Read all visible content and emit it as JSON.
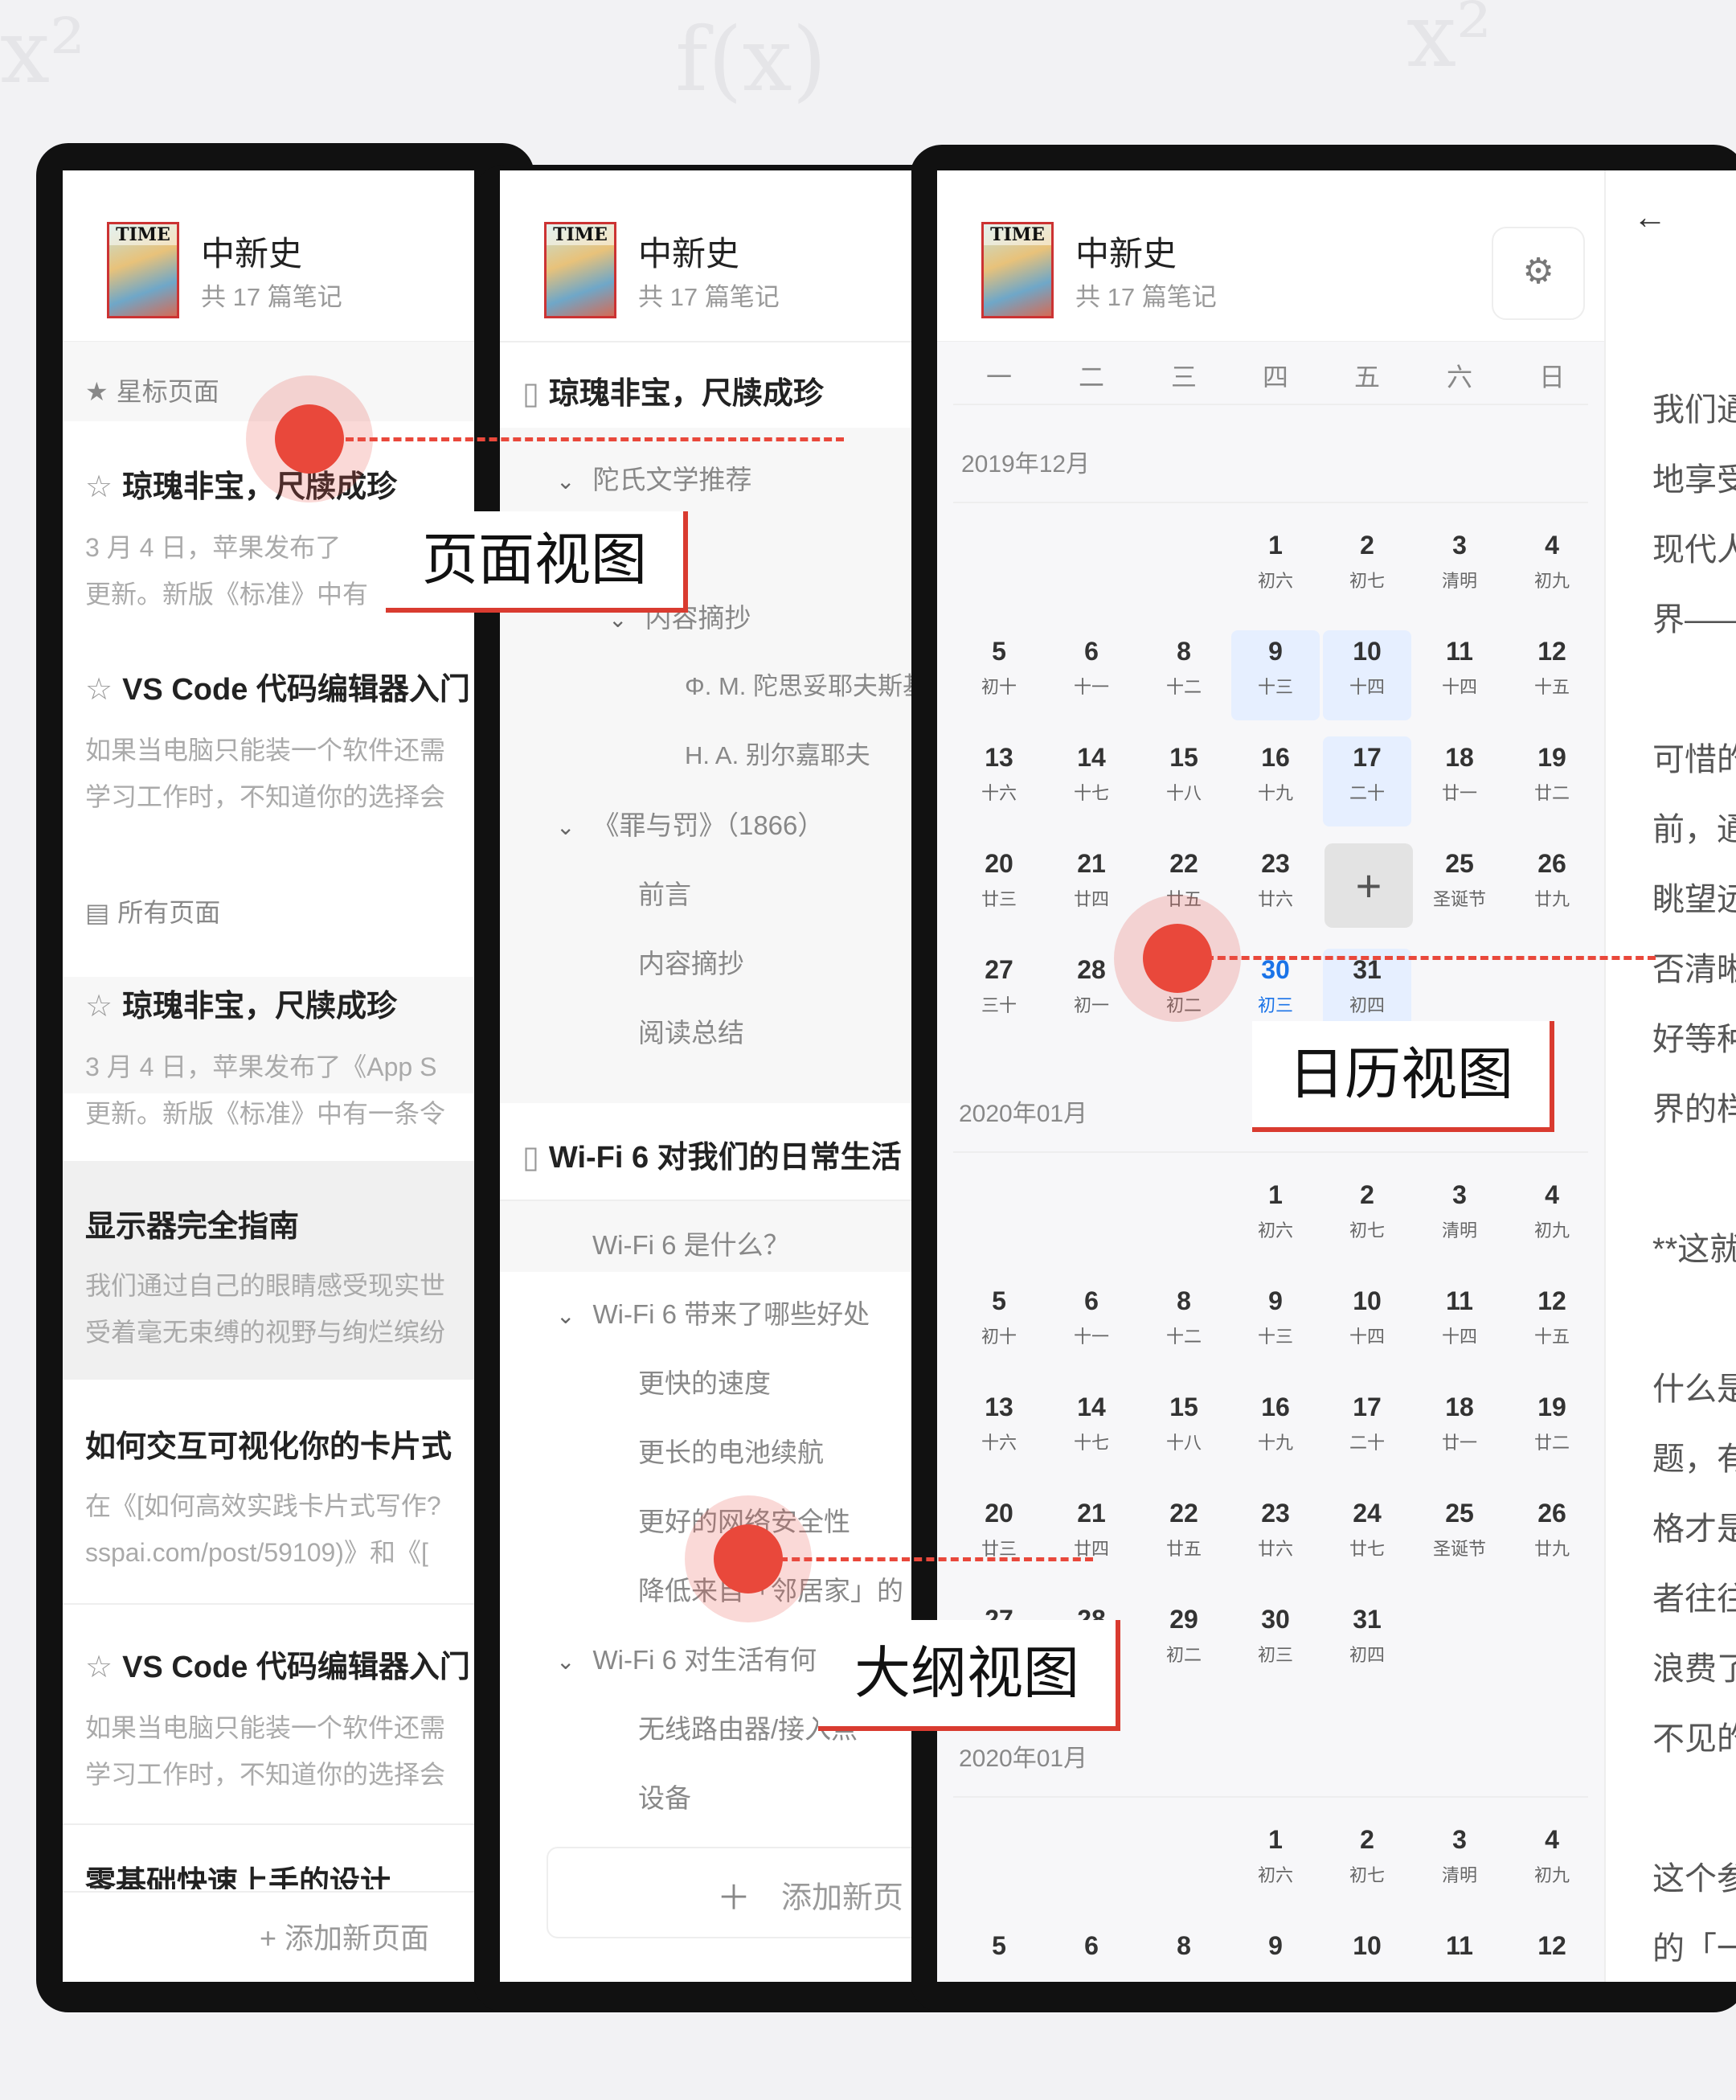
{
  "colors": {
    "accent": "#e9483b",
    "highlight_bg": "#e6efff",
    "today": "#1a73e8"
  },
  "notebook": {
    "title": "中新史",
    "count": "共 17 篇笔记",
    "cover_text": "TIME"
  },
  "page_view": {
    "starred_label": "星标页面",
    "all_label": "所有页面",
    "add_label": "+ 添加新页面",
    "items": [
      {
        "title": "琼瑰非宝，尺牍成珍",
        "excerpt": [
          "3 月 4 日，苹果发布了",
          "更新。新版《标准》中有"
        ]
      },
      {
        "title": "VS Code 代码编辑器入门",
        "excerpt": [
          "如果当电脑只能装一个软件还需",
          "学习工作时，不知道你的选择会"
        ]
      },
      {
        "title": "琼瑰非宝，尺牍成珍",
        "excerpt": [
          "3 月 4 日，苹果发布了《App S",
          "更新。新版《标准》中有一条令"
        ]
      },
      {
        "title": "显示器完全指南",
        "excerpt": [
          "我们通过自己的眼睛感受现实世",
          "受着毫无束缚的视野与绚烂缤纷"
        ]
      },
      {
        "title": "如何交互可视化你的卡片式",
        "excerpt": [
          "在《[如何高效实践卡片式写作?",
          "sspai.com/post/59109)》和《["
        ]
      },
      {
        "title": "VS Code 代码编辑器入门",
        "excerpt": [
          "如果当电脑只能装一个软件还需",
          "学习工作时，不知道你的选择会"
        ]
      },
      {
        "title": "零基础快速上手的设计",
        "excerpt": []
      }
    ]
  },
  "outline_view": {
    "doc1": "琼瑰非宝，尺牍成珍",
    "doc2": "Wi-Fi 6 对我们的日常生活",
    "add_label": "添加新页",
    "items": [
      {
        "text": "陀氏文学推荐",
        "chev": true
      },
      {
        "text": "前言",
        "chev": false
      },
      {
        "text": "内容摘抄",
        "chev": true
      },
      {
        "text": "Φ. M. 陀思妥耶夫斯基",
        "chev": false
      },
      {
        "text": "H. A. 别尔嘉耶夫",
        "chev": false
      },
      {
        "text": "《罪与罚》（1866）",
        "chev": true
      },
      {
        "text": "前言",
        "chev": false
      },
      {
        "text": "内容摘抄",
        "chev": false
      },
      {
        "text": "阅读总结",
        "chev": false
      },
      {
        "text": "Wi-Fi 6 是什么？",
        "chev": false
      },
      {
        "text": "Wi-Fi 6 带来了哪些好处",
        "chev": true
      },
      {
        "text": "更快的速度",
        "chev": false
      },
      {
        "text": "更长的电池续航",
        "chev": false
      },
      {
        "text": "更好的网络安全性",
        "chev": false
      },
      {
        "text": "降低来自「邻居家」的",
        "chev": false
      },
      {
        "text": "Wi-Fi 6 对生活有何",
        "chev": true
      },
      {
        "text": "无线路由器/接入点",
        "chev": false
      },
      {
        "text": "设备",
        "chev": false
      }
    ]
  },
  "calendar_view": {
    "weekdays": [
      "一",
      "二",
      "三",
      "四",
      "五",
      "六",
      "日"
    ],
    "months": [
      "2019年12月",
      "2020年01月",
      "2020年01月"
    ],
    "dec_rows": [
      [
        null,
        null,
        null,
        [
          "1",
          "初六"
        ],
        [
          "2",
          "初七"
        ],
        [
          "3",
          "清明"
        ],
        [
          "4",
          "初九"
        ]
      ],
      [
        [
          "5",
          "初十"
        ],
        [
          "6",
          "十一"
        ],
        [
          "8",
          "十二"
        ],
        [
          "9",
          "十三"
        ],
        [
          "10",
          "十四"
        ],
        [
          "11",
          "十四"
        ],
        [
          "12",
          "十五"
        ]
      ],
      [
        [
          "13",
          "十六"
        ],
        [
          "14",
          "十七"
        ],
        [
          "15",
          "十八"
        ],
        [
          "16",
          "十九"
        ],
        [
          "17",
          "二十"
        ],
        [
          "18",
          "廿一"
        ],
        [
          "19",
          "廿二"
        ]
      ],
      [
        [
          "20",
          "廿三"
        ],
        [
          "21",
          "廿四"
        ],
        [
          "22",
          "廿五"
        ],
        [
          "23",
          "廿六"
        ],
        [
          "+",
          ""
        ],
        [
          "25",
          "圣诞节"
        ],
        [
          "26",
          "廿九"
        ]
      ],
      [
        [
          "27",
          "三十"
        ],
        [
          "28",
          "初一"
        ],
        [
          "29",
          "初二"
        ],
        [
          "30",
          "初三"
        ],
        [
          "31",
          "初四"
        ],
        null,
        null
      ]
    ],
    "jan_rows": [
      [
        null,
        null,
        null,
        [
          "1",
          "初六"
        ],
        [
          "2",
          "初七"
        ],
        [
          "3",
          "清明"
        ],
        [
          "4",
          "初九"
        ]
      ],
      [
        [
          "5",
          "初十"
        ],
        [
          "6",
          "十一"
        ],
        [
          "8",
          "十二"
        ],
        [
          "9",
          "十三"
        ],
        [
          "10",
          "十四"
        ],
        [
          "11",
          "十四"
        ],
        [
          "12",
          "十五"
        ]
      ],
      [
        [
          "13",
          "十六"
        ],
        [
          "14",
          "十七"
        ],
        [
          "15",
          "十八"
        ],
        [
          "16",
          "十九"
        ],
        [
          "17",
          "二十"
        ],
        [
          "18",
          "廿一"
        ],
        [
          "19",
          "廿二"
        ]
      ],
      [
        [
          "20",
          "廿三"
        ],
        [
          "21",
          "廿四"
        ],
        [
          "22",
          "廿五"
        ],
        [
          "23",
          "廿六"
        ],
        [
          "24",
          "廿七"
        ],
        [
          "25",
          "圣诞节"
        ],
        [
          "26",
          "廿九"
        ]
      ],
      [
        [
          "27",
          "三十"
        ],
        [
          "28",
          "初一"
        ],
        [
          "29",
          "初二"
        ],
        [
          "30",
          "初三"
        ],
        [
          "31",
          "初四"
        ],
        null,
        null
      ]
    ],
    "jan2_rows": [
      [
        null,
        null,
        null,
        [
          "1",
          "初六"
        ],
        [
          "2",
          "初七"
        ],
        [
          "3",
          "清明"
        ],
        [
          "4",
          "初九"
        ]
      ],
      [
        [
          "5",
          ""
        ],
        [
          "6",
          ""
        ],
        [
          "8",
          ""
        ],
        [
          "9",
          ""
        ],
        [
          "10",
          ""
        ],
        [
          "11",
          ""
        ],
        [
          "12",
          ""
        ]
      ]
    ]
  },
  "reader": {
    "back": "←",
    "lines": [
      "我们通",
      "地享受",
      "现代人",
      "界——",
      "",
      "可惜的",
      "前，通",
      "眺望远",
      "否清晰",
      "好等种",
      "界的样",
      "",
      "**这就",
      "",
      "什么是",
      "题，有",
      "格才是",
      "者往往",
      "浪费了",
      "不见的",
      "",
      "这个参",
      "的「一"
    ]
  },
  "callouts": {
    "page": "页面视图",
    "calendar": "日历视图",
    "outline": "大纲视图"
  }
}
